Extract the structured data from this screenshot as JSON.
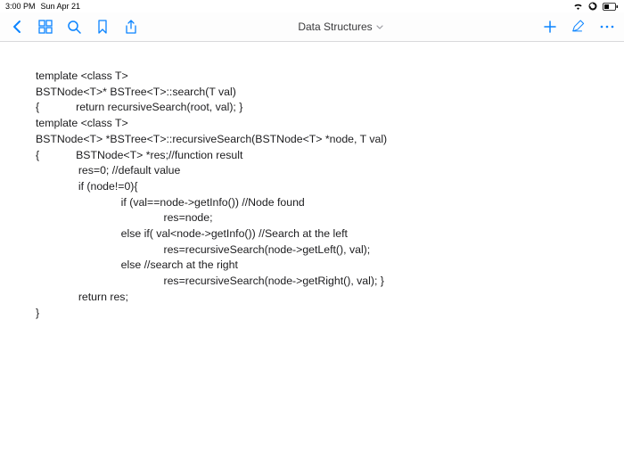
{
  "statusbar": {
    "time": "3:00 PM",
    "date": "Sun Apr 21"
  },
  "toolbar": {
    "title": "Data Structures"
  },
  "code": {
    "l01": "template <class T>",
    "l02": "BSTNode<T>* BSTree<T>::search(T val)",
    "l03": "{            return recursiveSearch(root, val); }",
    "l04": "",
    "l05": "template <class T>",
    "l06": "BSTNode<T> *BSTree<T>::recursiveSearch(BSTNode<T> *node, T val)",
    "l07": "{            BSTNode<T> *res;//function result",
    "l08": "              res=0; //default value",
    "l09": "              if (node!=0){",
    "l10": "                            if (val==node->getInfo()) //Node found",
    "l11": "                                          res=node;",
    "l12": "                            else if( val<node->getInfo()) //Search at the left",
    "l13": "                                          res=recursiveSearch(node->getLeft(), val);",
    "l14": "                            else //search at the right",
    "l15": "                                          res=recursiveSearch(node->getRight(), val); }",
    "l16": "              return res;",
    "l17": "}"
  }
}
